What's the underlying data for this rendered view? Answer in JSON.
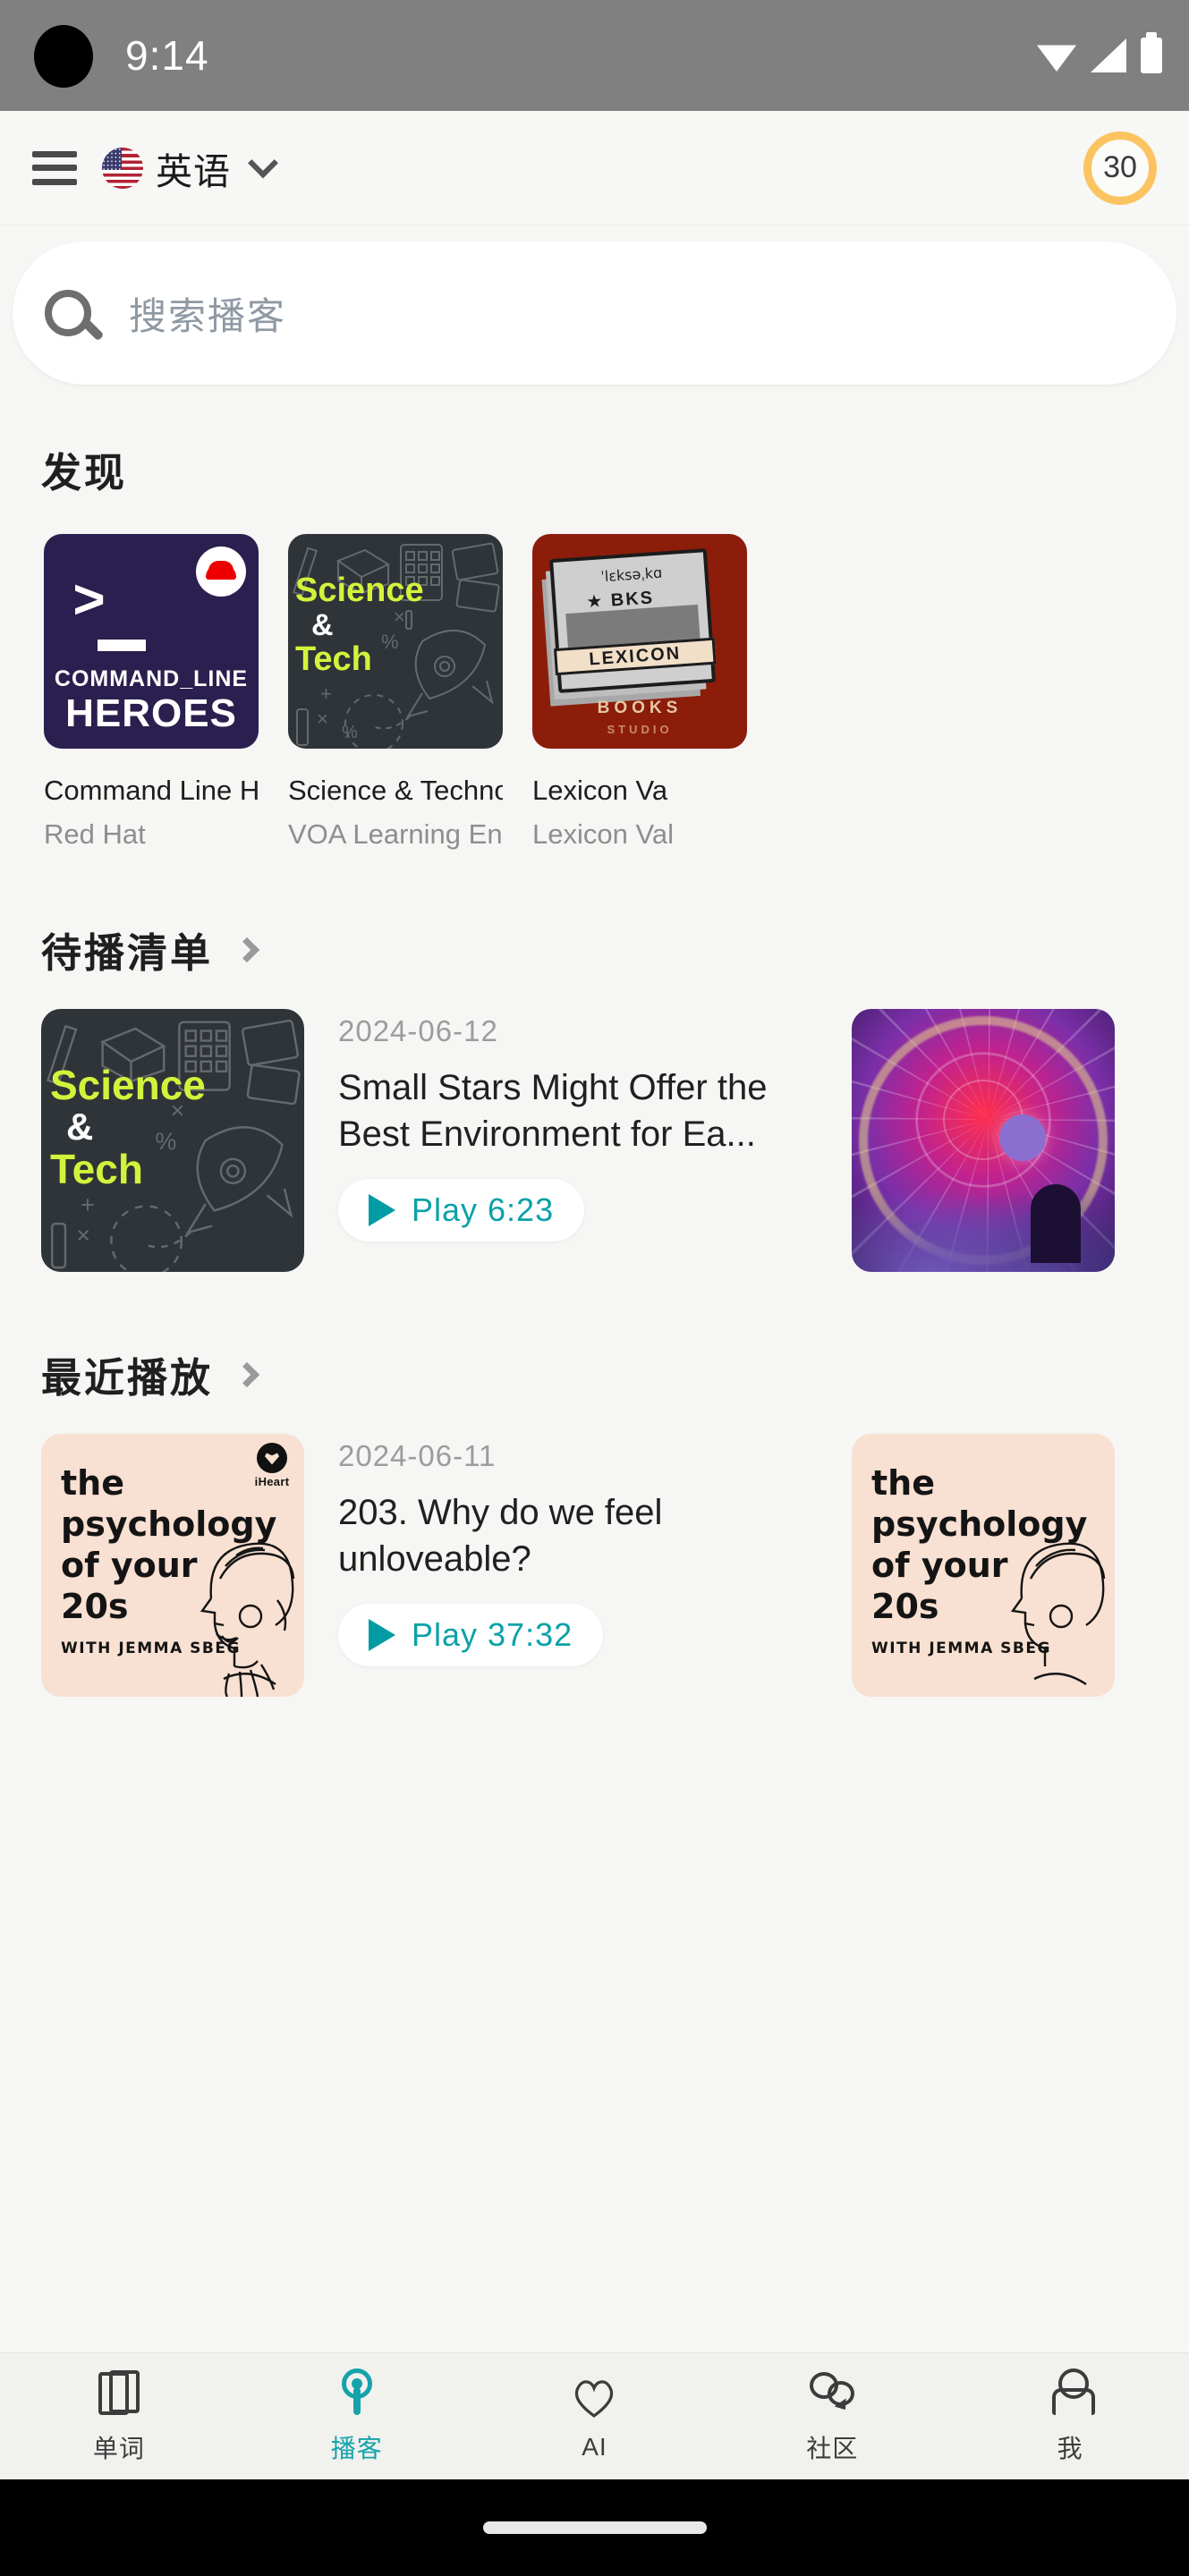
{
  "status_bar": {
    "time": "9:14",
    "icons": [
      "wifi-icon",
      "signal-icon",
      "battery-icon"
    ]
  },
  "app_bar": {
    "menu_icon": "hamburger-menu-icon",
    "flag_icon": "us-flag-icon",
    "language": "英语",
    "dropdown_icon": "chevron-down-icon",
    "streak_count": "30",
    "streak_ring_color": "#fbc461"
  },
  "search": {
    "icon": "search-icon",
    "placeholder": "搜索播客"
  },
  "discover": {
    "title": "发现",
    "podcasts": [
      {
        "title": "Command Line Her...",
        "author": "Red Hat",
        "art": {
          "bg": "#2a1f4e",
          "line1": "COMMAND_LINE",
          "line2": "HEROES",
          "prompt": ">",
          "badge": "red-hat-logo"
        }
      },
      {
        "title": "Science & Technol...",
        "author": "VOA Learning English",
        "art": {
          "bg": "#2f3438",
          "line1": "Science",
          "amp": "&",
          "line2": "Tech",
          "accent": "#d4f23c"
        }
      },
      {
        "title": "Lexicon Va",
        "author": "Lexicon Val",
        "art": {
          "bg": "#8c1d0b",
          "ipa": "ˈlɛksəˌkɑ",
          "bks": "★ BKS",
          "band": "LEXICON",
          "books": "BOOKS",
          "studio": "STUDIO"
        }
      }
    ]
  },
  "queue": {
    "title": "待播清单",
    "chevron_icon": "chevron-right-icon",
    "episodes": [
      {
        "date": "2024-06-12",
        "title": "Small Stars Might Offer the Best Environment for Ea...",
        "play_label": "Play 6:23",
        "art": "science-and-tech-artwork"
      },
      {
        "date": "",
        "title": "",
        "play_label": "",
        "art": "spider-web-artwork"
      }
    ]
  },
  "recent": {
    "title": "最近播放",
    "chevron_icon": "chevron-right-icon",
    "episodes": [
      {
        "date": "2024-06-11",
        "title": "203. Why do we feel unloveable?",
        "play_label": "Play 37:32",
        "art": "psychology-of-your-20s-artwork"
      },
      {
        "date": "",
        "title": "",
        "play_label": "",
        "art": "psychology-of-your-20s-artwork"
      }
    ]
  },
  "psychology_art": {
    "l1": "the",
    "l2": "psychology",
    "l3": "of your",
    "l4": "20s",
    "l5": "WITH JEMMA SBEG",
    "brand": "iHeart",
    "bg": "#f8e0d2"
  },
  "bottom_nav": {
    "active_color": "#14a3ab",
    "items": [
      {
        "label": "单词",
        "icon": "cards-icon",
        "active": false
      },
      {
        "label": "播客",
        "icon": "podcast-icon",
        "active": true
      },
      {
        "label": "AI",
        "icon": "heart-icon",
        "active": false
      },
      {
        "label": "社区",
        "icon": "chat-icon",
        "active": false
      },
      {
        "label": "我",
        "icon": "person-icon",
        "active": false
      }
    ]
  }
}
